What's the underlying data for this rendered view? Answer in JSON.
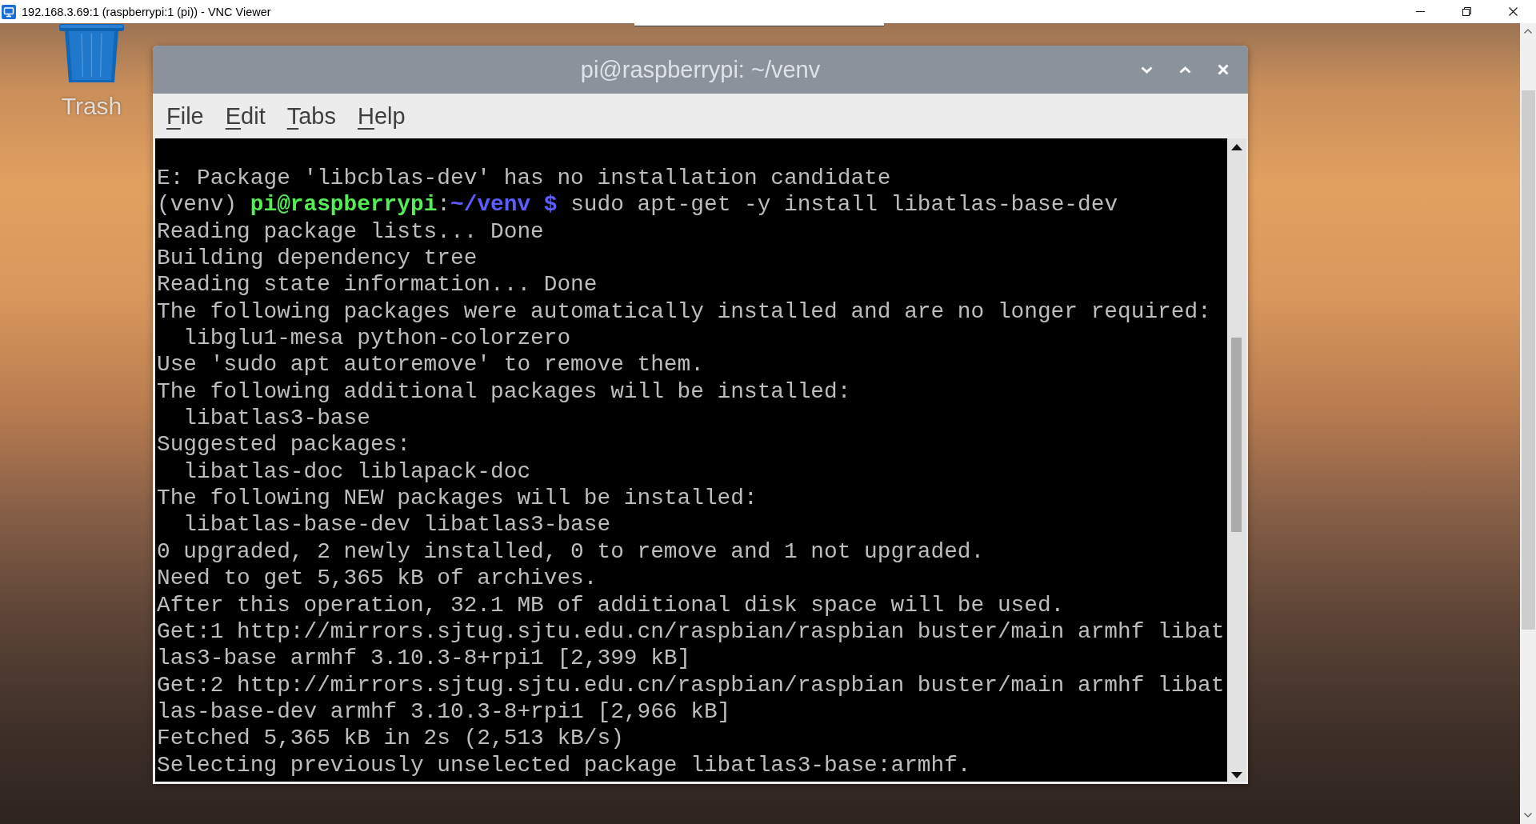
{
  "vnc_window": {
    "title": "192.168.3.69:1 (raspberrypi:1 (pi)) - VNC Viewer"
  },
  "desktop": {
    "icons": [
      {
        "kind": "trash",
        "label": "Trash"
      }
    ]
  },
  "terminal": {
    "title": "pi@raspberrypi: ~/venv",
    "menu": [
      "File",
      "Edit",
      "Tabs",
      "Help"
    ],
    "lines": [
      {
        "kind": "output",
        "text": "E: Package 'libcblas-dev' has no installation candidate"
      },
      {
        "kind": "prompt",
        "segments": [
          {
            "kind": "plain",
            "text": "(venv) "
          },
          {
            "kind": "user_host",
            "text": "pi@raspberrypi"
          },
          {
            "kind": "plain",
            "text": ":"
          },
          {
            "kind": "path",
            "text": "~/venv $"
          },
          {
            "kind": "plain",
            "text": " sudo apt-get -y install libatlas-base-dev"
          }
        ]
      },
      {
        "kind": "output",
        "text": "Reading package lists... Done"
      },
      {
        "kind": "output",
        "text": "Building dependency tree"
      },
      {
        "kind": "output",
        "text": "Reading state information... Done"
      },
      {
        "kind": "output",
        "text": "The following packages were automatically installed and are no longer required:"
      },
      {
        "kind": "output",
        "text": "  libglu1-mesa python-colorzero"
      },
      {
        "kind": "output",
        "text": "Use 'sudo apt autoremove' to remove them."
      },
      {
        "kind": "output",
        "text": "The following additional packages will be installed:"
      },
      {
        "kind": "output",
        "text": "  libatlas3-base"
      },
      {
        "kind": "output",
        "text": "Suggested packages:"
      },
      {
        "kind": "output",
        "text": "  libatlas-doc liblapack-doc"
      },
      {
        "kind": "output",
        "text": "The following NEW packages will be installed:"
      },
      {
        "kind": "output",
        "text": "  libatlas-base-dev libatlas3-base"
      },
      {
        "kind": "output",
        "text": "0 upgraded, 2 newly installed, 0 to remove and 1 not upgraded."
      },
      {
        "kind": "output",
        "text": "Need to get 5,365 kB of archives."
      },
      {
        "kind": "output",
        "text": "After this operation, 32.1 MB of additional disk space will be used."
      },
      {
        "kind": "output",
        "text": "Get:1 http://mirrors.sjtug.sjtu.edu.cn/raspbian/raspbian buster/main armhf libat"
      },
      {
        "kind": "output",
        "text": "las3-base armhf 3.10.3-8+rpi1 [2,399 kB]"
      },
      {
        "kind": "output",
        "text": "Get:2 http://mirrors.sjtug.sjtu.edu.cn/raspbian/raspbian buster/main armhf libat"
      },
      {
        "kind": "output",
        "text": "las-base-dev armhf 3.10.3-8+rpi1 [2,966 kB]"
      },
      {
        "kind": "output",
        "text": "Fetched 5,365 kB in 2s (2,513 kB/s)"
      },
      {
        "kind": "output",
        "text": "Selecting previously unselected package libatlas3-base:armhf."
      }
    ]
  }
}
